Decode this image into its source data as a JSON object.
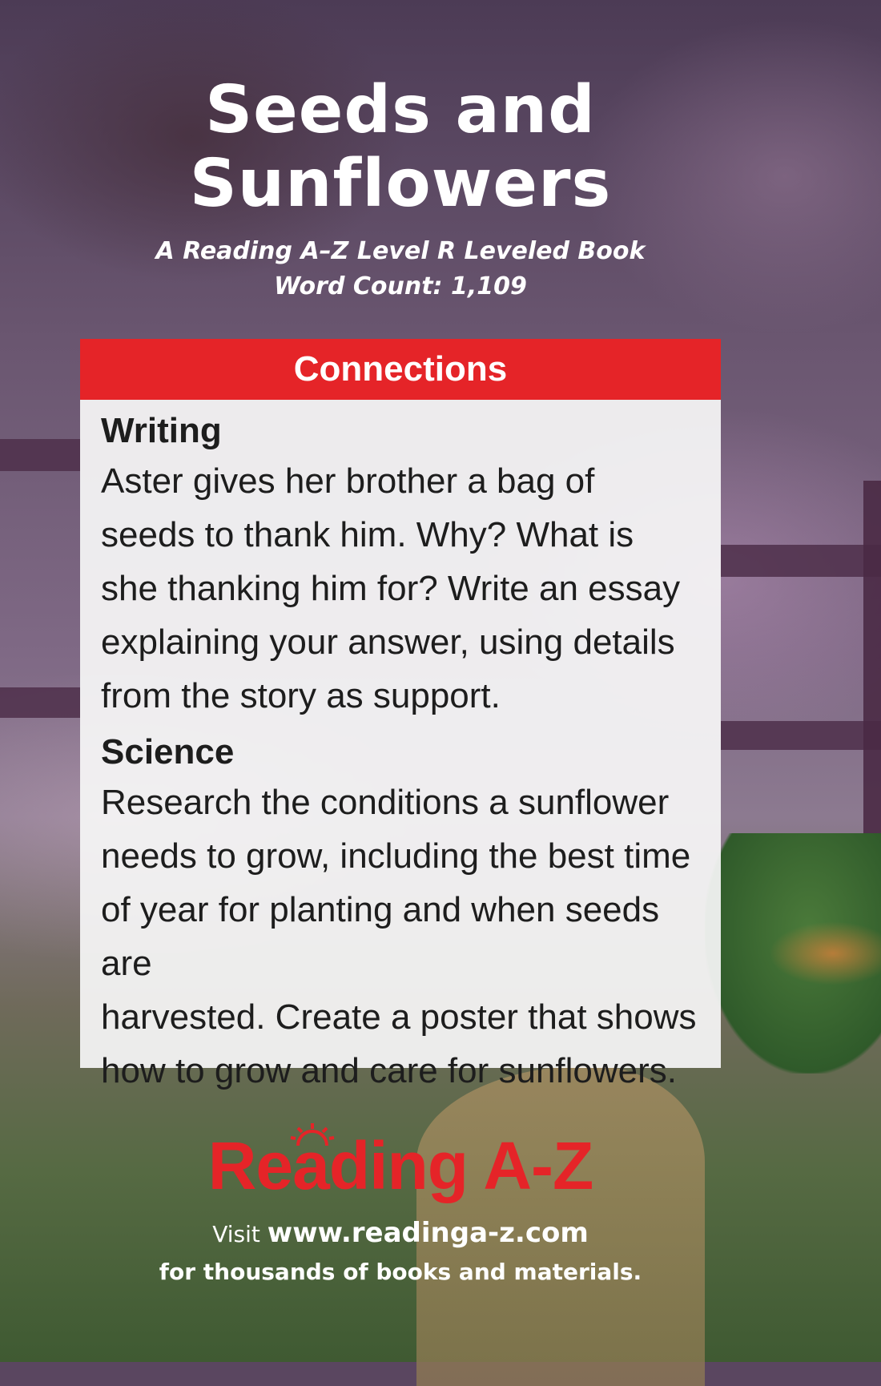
{
  "book": {
    "title_line1": "Seeds and",
    "title_line2": "Sunflowers",
    "subtitle_line1": "A Reading A–Z Level R Leveled Book",
    "subtitle_line2": "Word Count: 1,109"
  },
  "connections": {
    "header": "Connections",
    "sections": [
      {
        "heading": "Writing",
        "text": "Aster gives her brother a bag of\nseeds to thank him. Why? What is\nshe thanking him for? Write an essay\nexplaining your answer, using details\nfrom the story as support."
      },
      {
        "heading": "Science",
        "text": "Research the conditions a sunflower\nneeds to grow, including the best time\nof year for planting and when seeds are\nharvested. Create a poster that shows\nhow to grow and care for sunflowers."
      }
    ]
  },
  "footer": {
    "logo_text": "Reading A-Z",
    "visit_label": "Visit",
    "url": "www.readinga-z.com",
    "tagline": "for thousands of books and materials."
  },
  "colors": {
    "accent_red": "#e52428",
    "card_background": "#f6f6f6",
    "text": "#1d1d1d"
  }
}
